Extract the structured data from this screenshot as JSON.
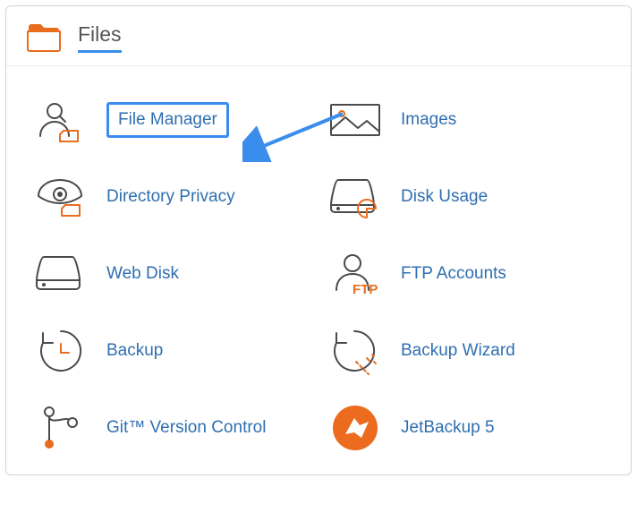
{
  "panel": {
    "title": "Files",
    "items": [
      {
        "label": "File Manager",
        "selected": true
      },
      {
        "label": "Images"
      },
      {
        "label": "Directory Privacy"
      },
      {
        "label": "Disk Usage"
      },
      {
        "label": "Web Disk"
      },
      {
        "label": "FTP Accounts"
      },
      {
        "label": "Backup"
      },
      {
        "label": "Backup Wizard"
      },
      {
        "label": "Git™ Version Control"
      },
      {
        "label": "JetBackup 5"
      }
    ]
  },
  "annotation": {
    "arrow_color": "#3b8ded"
  }
}
